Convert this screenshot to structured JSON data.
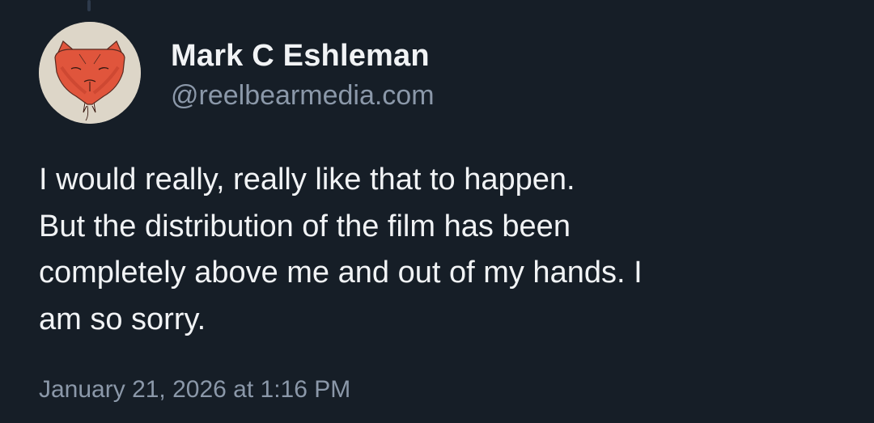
{
  "author": {
    "display_name": "Mark C Eshleman",
    "handle": "@reelbearmedia.com",
    "avatar_icon": "bear-face-sketch-icon"
  },
  "post": {
    "lines": [
      "I would really, really like that to happen.",
      "But the distribution of the film has been",
      "completely above me and out of my hands. I",
      "am so sorry."
    ],
    "timestamp": "January 21, 2026 at 1:16 PM"
  },
  "colors": {
    "background": "#161e27",
    "text_primary": "#f1f3f5",
    "text_secondary": "#8b98a9",
    "avatar_bg": "#ddd6c8",
    "avatar_accent": "#e0553c"
  }
}
